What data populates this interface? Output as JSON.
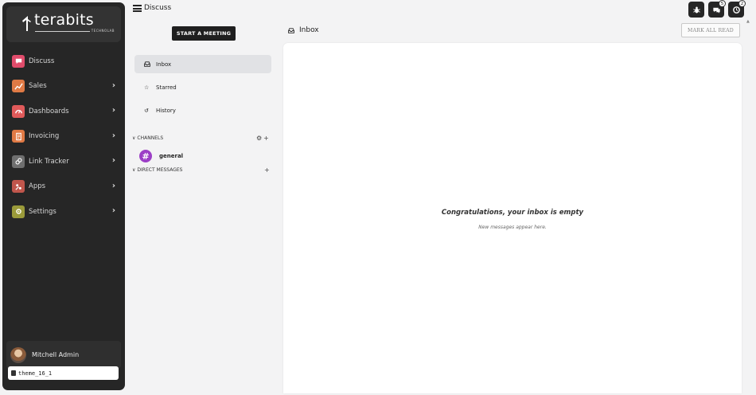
{
  "brand": {
    "name": "terabits",
    "tagline": "TECHNOLAB"
  },
  "topbar": {
    "title": "Discuss",
    "badges": {
      "chat": "5",
      "activity": "2"
    }
  },
  "sidebar": {
    "items": [
      {
        "label": "Discuss",
        "icon": "chat-icon",
        "color": "#e04c6b",
        "has_chevron": false
      },
      {
        "label": "Sales",
        "icon": "chart-icon",
        "color": "#e07a45",
        "has_chevron": true
      },
      {
        "label": "Dashboards",
        "icon": "gauge-icon",
        "color": "#e05a5a",
        "has_chevron": true
      },
      {
        "label": "Invoicing",
        "icon": "invoice-icon",
        "color": "#e07a45",
        "has_chevron": true
      },
      {
        "label": "Link Tracker",
        "icon": "link-icon",
        "color": "#6f6f6f",
        "has_chevron": true
      },
      {
        "label": "Apps",
        "icon": "apps-icon",
        "color": "#c0564c",
        "has_chevron": true
      },
      {
        "label": "Settings",
        "icon": "gear-icon",
        "color": "#9a9a3a",
        "has_chevron": true
      }
    ],
    "user": "Mitchell Admin",
    "database": "theme_16_1"
  },
  "discuss": {
    "meeting_button": "START A MEETING",
    "nav": [
      {
        "label": "Inbox",
        "icon": "inbox-icon",
        "active": true
      },
      {
        "label": "Starred",
        "icon": "star-icon",
        "active": false
      },
      {
        "label": "History",
        "icon": "history-icon",
        "active": false
      }
    ],
    "channels_header": "CHANNELS",
    "channels": [
      {
        "name": "general",
        "icon": "hash-icon"
      }
    ],
    "dm_header": "DIRECT MESSAGES"
  },
  "main": {
    "title": "Inbox",
    "mark_all_read": "MARK ALL READ",
    "empty_title": "Congratulations, your inbox is empty",
    "empty_subtitle": "New messages appear here."
  },
  "colors": {
    "sidebar_bg": "#262626",
    "channel_badge": "#9c3fc6",
    "active_nav": "#e1e2e5"
  }
}
